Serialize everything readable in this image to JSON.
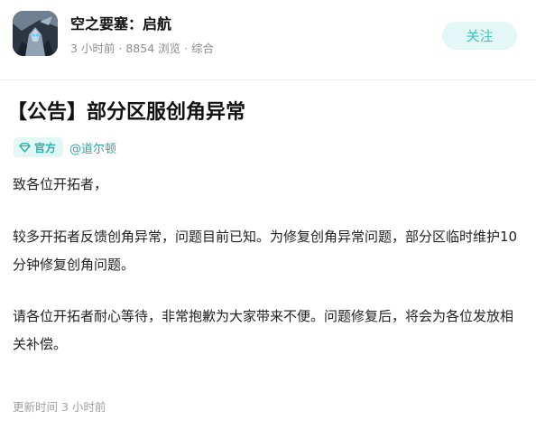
{
  "author": {
    "name": "空之要塞：启航",
    "meta": "3 小时前 · 8854 浏览 · 综合"
  },
  "follow_label": "关注",
  "post": {
    "title": "【公告】部分区服创角异常",
    "tag_label": "官方",
    "mention": "@道尔顿",
    "paragraphs": [
      "致各位开拓者，",
      "较多开拓者反馈创角异常，问题目前已知。为修复创角异常问题，部分区临时维护10分钟修复创角问题。",
      "请各位开拓者耐心等待，非常抱歉为大家带来不便。问题修复后，将会为各位发放相关补偿。"
    ],
    "updated": "更新时间 3 小时前"
  },
  "colors": {
    "accent": "#3dc2bb",
    "accent_bg": "#e3f7f6",
    "meta_text": "#8c8c8c"
  },
  "icons": {
    "tag": "diamond-icon",
    "avatar": "game-avatar"
  }
}
